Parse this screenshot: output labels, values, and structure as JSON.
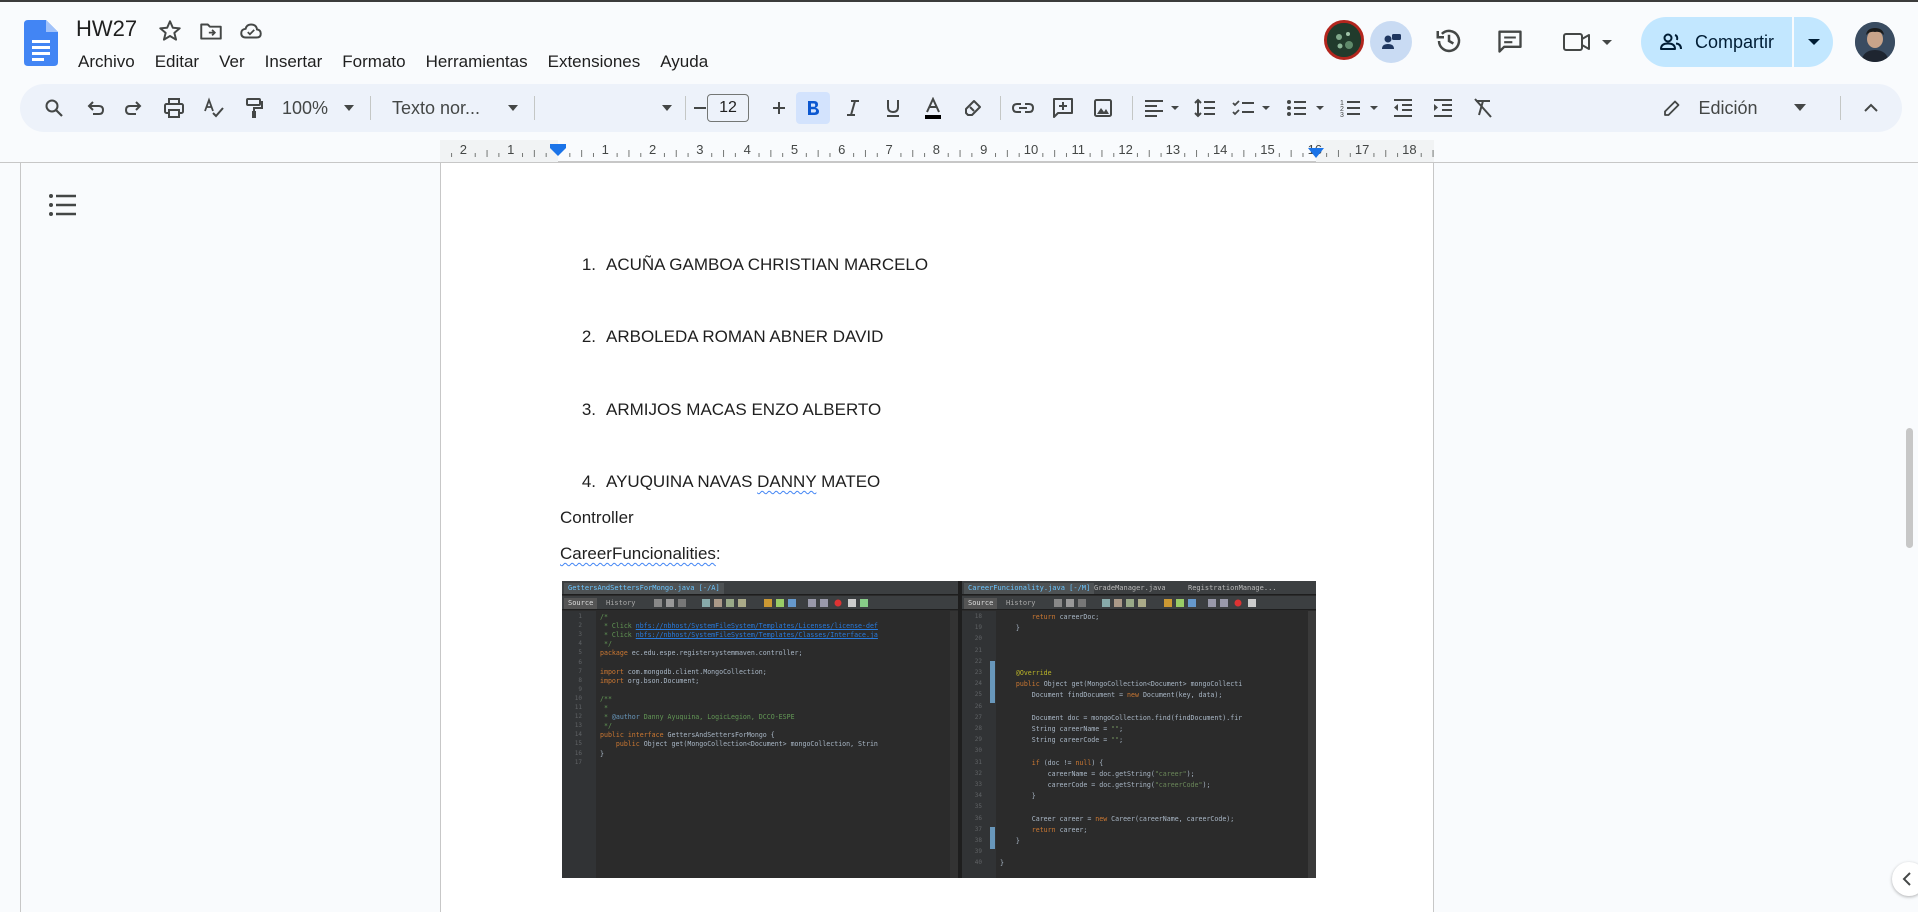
{
  "document": {
    "title": "HW27",
    "menu": [
      "Archivo",
      "Editar",
      "Ver",
      "Insertar",
      "Formato",
      "Herramientas",
      "Extensiones",
      "Ayuda"
    ],
    "share_label": "Compartir"
  },
  "toolbar": {
    "zoom": "100%",
    "style": "Texto nor...",
    "font": "",
    "font_size": "12",
    "mode": "Edición"
  },
  "ruler": {
    "marks": [
      "2",
      "1",
      "1",
      "2",
      "3",
      "4",
      "5",
      "6",
      "7",
      "8",
      "9",
      "10",
      "11",
      "12",
      "13",
      "14",
      "15",
      "16",
      "17",
      "18"
    ]
  },
  "body": {
    "list": [
      {
        "num": "1.",
        "text": "ACUÑA GAMBOA CHRISTIAN MARCELO"
      },
      {
        "num": "2.",
        "text": "ARBOLEDA ROMAN ABNER DAVID"
      },
      {
        "num": "3.",
        "text": "ARMIJOS MACAS ENZO ALBERTO"
      },
      {
        "num": "4.",
        "text_before": "AYUQUINA NAVAS ",
        "text_flag": "DANNY",
        "text_after": " MATEO"
      }
    ],
    "controller": "Controller",
    "career_title": "CareerFuncionalities",
    "career_colon": ":"
  },
  "ide": {
    "left_tabs": [
      "GettersAndSettersForMongo.java [-/A]"
    ],
    "right_tabs": [
      "CareerFuncionality.java [-/M]",
      "GradeManager.java",
      "RegistrationManage..."
    ],
    "source_label": "Source",
    "history_label": "History",
    "left_code": [
      {
        "n": "1",
        "t": "/*"
      },
      {
        "n": "2",
        "t": " * Click nbfs://nbhost/SystemFileSystem/Templates/Licenses/license-def"
      },
      {
        "n": "3",
        "t": " * Click nbfs://nbhost/SystemFileSystem/Templates/Classes/Interface.ja"
      },
      {
        "n": "4",
        "t": " */"
      },
      {
        "n": "5",
        "t": "package ec.edu.espe.registersystemmaven.controller;"
      },
      {
        "n": "6",
        "t": ""
      },
      {
        "n": "7",
        "t": "import com.mongodb.client.MongoCollection;"
      },
      {
        "n": "8",
        "t": "import org.bson.Document;"
      },
      {
        "n": "9",
        "t": ""
      },
      {
        "n": "10",
        "t": "/**"
      },
      {
        "n": "11",
        "t": " *"
      },
      {
        "n": "12",
        "t": " * @author Danny Ayuquina, LogicLegion, DCCO-ESPE"
      },
      {
        "n": "13",
        "t": " */"
      },
      {
        "n": "14",
        "t": "public interface GettersAndSettersForMongo {"
      },
      {
        "n": "15",
        "t": "    public Object get(MongoCollection<Document> mongoCollection, Strin"
      },
      {
        "n": "16",
        "t": "}"
      },
      {
        "n": "17",
        "t": ""
      }
    ],
    "right_code": [
      {
        "n": "18",
        "t": "        return careerDoc;"
      },
      {
        "n": "19",
        "t": "    }"
      },
      {
        "n": "20",
        "t": ""
      },
      {
        "n": "21",
        "t": ""
      },
      {
        "n": "22",
        "t": ""
      },
      {
        "n": "23",
        "t": "    @Override"
      },
      {
        "n": "24",
        "t": "    public Object get(MongoCollection<Document> mongoCollecti"
      },
      {
        "n": "25",
        "t": "        Document findDocument = new Document(key, data);"
      },
      {
        "n": "26",
        "t": ""
      },
      {
        "n": "27",
        "t": "        Document doc = mongoCollection.find(findDocument).fir"
      },
      {
        "n": "28",
        "t": "        String careerName = \"\";"
      },
      {
        "n": "29",
        "t": "        String careerCode = \"\";"
      },
      {
        "n": "30",
        "t": ""
      },
      {
        "n": "31",
        "t": "        if (doc != null) {"
      },
      {
        "n": "32",
        "t": "            careerName = doc.getString(\"career\");"
      },
      {
        "n": "33",
        "t": "            careerCode = doc.getString(\"careerCode\");"
      },
      {
        "n": "34",
        "t": "        }"
      },
      {
        "n": "35",
        "t": ""
      },
      {
        "n": "36",
        "t": "        Career career = new Career(careerName, careerCode);"
      },
      {
        "n": "37",
        "t": "        return career;"
      },
      {
        "n": "38",
        "t": "    }"
      },
      {
        "n": "39",
        "t": ""
      },
      {
        "n": "40",
        "t": "}"
      }
    ]
  },
  "colors": {
    "accent": "#1a73e8",
    "share_bg": "#c2e7ff",
    "toolbar_bg": "#edf2fa",
    "doc_icon": "#4285f4"
  }
}
